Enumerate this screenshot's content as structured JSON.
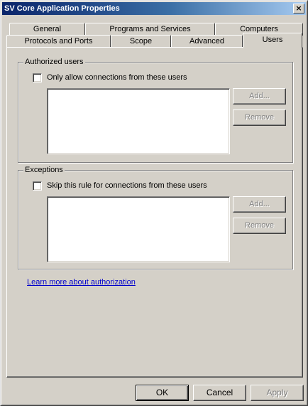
{
  "window": {
    "title": "SV Core Application Properties",
    "close_label": "×"
  },
  "tabs": {
    "row_back": [
      "General",
      "Programs and Services",
      "Computers"
    ],
    "row_front": [
      "Protocols and Ports",
      "Scope",
      "Advanced",
      "Users"
    ],
    "active": "Users"
  },
  "authorized": {
    "title": "Authorized users",
    "checkbox_label": "Only allow connections from these users",
    "checked": false,
    "add_label": "Add...",
    "remove_label": "Remove"
  },
  "exceptions": {
    "title": "Exceptions",
    "checkbox_label": "Skip this rule for connections from these users",
    "checked": false,
    "add_label": "Add...",
    "remove_label": "Remove"
  },
  "learn_more_link": "Learn more about authorization",
  "footer": {
    "ok_label": "OK",
    "cancel_label": "Cancel",
    "apply_label": "Apply"
  }
}
